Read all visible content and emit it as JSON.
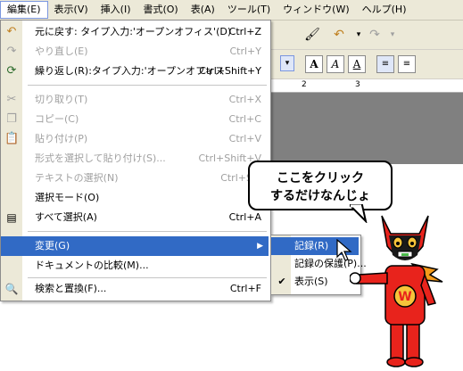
{
  "menubar": {
    "items": [
      {
        "label": "編集(E)",
        "active": true
      },
      {
        "label": "表示(V)"
      },
      {
        "label": "挿入(I)"
      },
      {
        "label": "書式(O)"
      },
      {
        "label": "表(A)"
      },
      {
        "label": "ツール(T)"
      },
      {
        "label": "ウィンドウ(W)"
      },
      {
        "label": "ヘルプ(H)"
      }
    ]
  },
  "ruler": {
    "marks": [
      "2",
      "3"
    ]
  },
  "edit_menu": {
    "items": [
      {
        "icon": "undo-icon",
        "label": "元に戻す: タイプ入力:'オープンオフィス'(D)",
        "shortcut": "Ctrl+Z",
        "disabled": false
      },
      {
        "icon": "redo-icon",
        "label": "やり直し(E)",
        "shortcut": "Ctrl+Y",
        "disabled": true
      },
      {
        "icon": "repeat-icon",
        "label": "繰り返し(R):タイプ入力:'オープンオフィス'",
        "shortcut": "Ctrl+Shift+Y",
        "disabled": false
      },
      {
        "icon": "cut-icon",
        "label": "切り取り(T)",
        "shortcut": "Ctrl+X",
        "disabled": true
      },
      {
        "icon": "copy-icon",
        "label": "コピー(C)",
        "shortcut": "Ctrl+C",
        "disabled": true
      },
      {
        "icon": "paste-icon",
        "label": "貼り付け(P)",
        "shortcut": "Ctrl+V",
        "disabled": true
      },
      {
        "icon": "",
        "label": "形式を選択して貼り付け(S)...",
        "shortcut": "Ctrl+Shift+V",
        "disabled": true
      },
      {
        "icon": "",
        "label": "テキストの選択(N)",
        "shortcut": "Ctrl+Shi",
        "disabled": true
      },
      {
        "icon": "",
        "label": "選択モード(O)",
        "shortcut": "",
        "disabled": false
      },
      {
        "icon": "select-all-icon",
        "label": "すべて選択(A)",
        "shortcut": "Ctrl+A",
        "disabled": false
      },
      {
        "icon": "",
        "label": "変更(G)",
        "shortcut": "",
        "disabled": false,
        "highlighted": true,
        "submenu": true
      },
      {
        "icon": "",
        "label": "ドキュメントの比較(M)...",
        "shortcut": "",
        "disabled": false
      },
      {
        "icon": "find-replace-icon",
        "label": "検索と置換(F)...",
        "shortcut": "Ctrl+F",
        "disabled": false
      }
    ]
  },
  "changes_submenu": {
    "items": [
      {
        "label": "記録(R)",
        "highlighted": true
      },
      {
        "label": "記録の保護(P)..."
      },
      {
        "label": "表示(S)",
        "checked": true
      }
    ]
  },
  "bubble": {
    "line1": "ここをクリック",
    "line2": "するだけなんじょ"
  },
  "colors": {
    "highlight": "#316ac5",
    "menu_bg": "#ece9d8"
  }
}
